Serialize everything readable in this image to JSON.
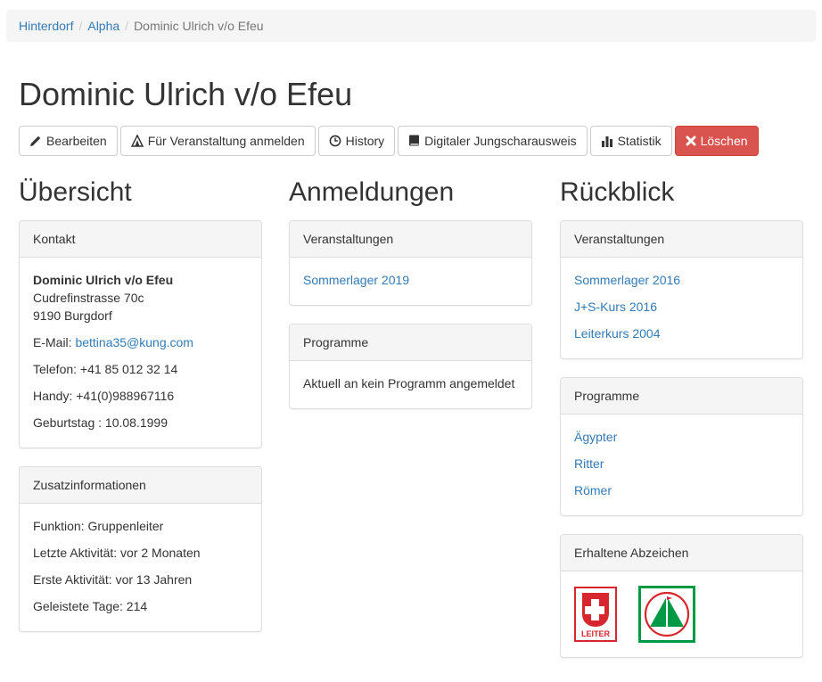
{
  "breadcrumb": {
    "items": [
      "Hinterdorf",
      "Alpha"
    ],
    "current": "Dominic Ulrich v/o Efeu",
    "separator": "/"
  },
  "page_title": "Dominic Ulrich v/o Efeu",
  "toolbar": {
    "edit": "Bearbeiten",
    "register": "Für Veranstaltung anmelden",
    "history": "History",
    "digital_card": "Digitaler Jungscharausweis",
    "statistics": "Statistik",
    "delete": "Löschen"
  },
  "overview": {
    "heading": "Übersicht",
    "contact": {
      "title": "Kontakt",
      "name": "Dominic Ulrich v/o Efeu",
      "street": "Cudrefinstrasse 70c",
      "city": "9190 Burgdorf",
      "email_label": "E-Mail:",
      "email": "bettina35@kung.com",
      "phone": "Telefon: +41 85 012 32 14",
      "mobile": "Handy: +41(0)988967116",
      "birthday": "Geburtstag : 10.08.1999"
    },
    "additional": {
      "title": "Zusatzinformationen",
      "function": "Funktion: Gruppenleiter",
      "last_activity": "Letzte Aktivität: vor 2 Monaten",
      "first_activity": "Erste Aktivität: vor 13 Jahren",
      "days": "Geleistete Tage: 214"
    }
  },
  "registrations": {
    "heading": "Anmeldungen",
    "events": {
      "title": "Veranstaltungen",
      "items": [
        "Sommerlager 2019"
      ]
    },
    "programs": {
      "title": "Programme",
      "empty": "Aktuell an kein Programm angemeldet"
    }
  },
  "review": {
    "heading": "Rückblick",
    "events": {
      "title": "Veranstaltungen",
      "items": [
        "Sommerlager 2016",
        "J+S-Kurs 2016",
        "Leiterkurs 2004"
      ]
    },
    "programs": {
      "title": "Programme",
      "items": [
        "Ägypter",
        "Ritter",
        "Römer"
      ]
    },
    "badges": {
      "title": "Erhaltene Abzeichen",
      "leiter_text": "LEITER"
    }
  },
  "colors": {
    "link": "#337ab7",
    "danger": "#d9534f",
    "badge_red": "#d7262e",
    "badge_green": "#009a47"
  },
  "icons": {
    "edit": "pencil-icon",
    "register": "tent-icon",
    "history": "clock-icon",
    "digital_card": "book-icon",
    "statistics": "bar-chart-icon",
    "delete": "close-icon"
  }
}
